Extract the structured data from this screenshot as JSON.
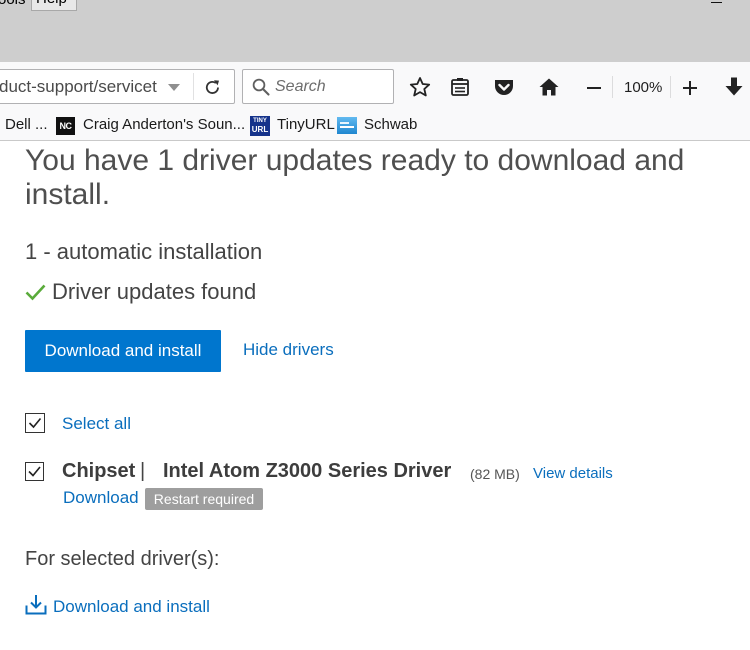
{
  "browser": {
    "menu_bar": {
      "tools_label": "ools",
      "help_label": "Help"
    },
    "nav_bar": {
      "url": "duct-support/servicet",
      "search_placeholder": "Search",
      "zoom_level": "100%",
      "icons": [
        "history-dropdown-icon",
        "reload-icon",
        "search-icon",
        "bookmark-star-icon",
        "library-icon",
        "pocket-icon",
        "home-icon",
        "zoom-out-icon",
        "zoom-in-icon",
        "downloads-icon"
      ]
    },
    "bookmarks": [
      {
        "label": "Dell ..."
      },
      {
        "label": "Craig Anderton's Soun...",
        "icon": "nc-favicon",
        "icon_text": "NC"
      },
      {
        "label": "TinyURL",
        "icon": "tinyurl-favicon",
        "icon_text_top": "TINY",
        "icon_text_bottom": "URL"
      },
      {
        "label": "Schwab",
        "icon": "schwab-favicon"
      }
    ]
  },
  "page": {
    "heading": "You have 1 driver updates ready to download and install.",
    "install_mode": "1 - automatic installation",
    "status": {
      "icon": "checkmark-icon",
      "text": "Driver updates found"
    },
    "primary_action": "Download and install",
    "hide_drivers": "Hide drivers",
    "select_all": {
      "checked": true,
      "label": "Select all"
    },
    "drivers": [
      {
        "checked": true,
        "category": "Chipset",
        "separator": "|",
        "name": "Intel Atom Z3000 Series Driver",
        "size": "(82 MB)",
        "details_link": "View details",
        "download_link": "Download",
        "badge": "Restart required"
      }
    ],
    "selected_section": {
      "label": "For selected driver(s):",
      "action": "Download and install",
      "action_icon": "download-tray-icon"
    }
  },
  "colors": {
    "accent": "#0076ce",
    "link": "#0a6ebd",
    "success": "#5aab3a",
    "badge": "#9e9e9e",
    "text": "#444444"
  }
}
